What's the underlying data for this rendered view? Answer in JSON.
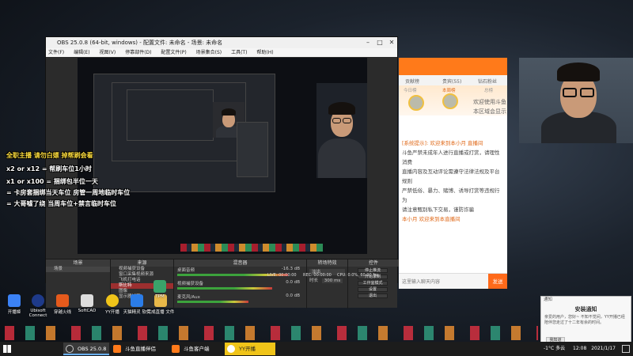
{
  "obs": {
    "title": "OBS 25.0.8 (64-bit, windows) - 配置文件: 未命名 - 场景: 未命名",
    "menu": [
      "文件(F)",
      "编辑(E)",
      "视图(V)",
      "停靠部件(D)",
      "配置文件(P)",
      "场景集合(S)",
      "工具(T)",
      "帮助(H)"
    ],
    "docks": {
      "scenes_header": "场景",
      "scene_item": "场景",
      "sources_header": "来源",
      "sources": [
        "视频捕获设备",
        "窗口采集视频来源",
        "飞机打电话",
        "斯比特",
        "图像",
        "显示器捕获"
      ],
      "mixer_header": "混音器",
      "mixer_channels": [
        {
          "name": "桌面音频",
          "level": "-16.3 dB"
        },
        {
          "name": "视频捕获设备",
          "level": "0.0 dB"
        },
        {
          "name": "麦克风/Aux",
          "level": "0.0 dB"
        }
      ],
      "transitions_header": "转场特效",
      "transition": "淡出",
      "duration_label": "时长",
      "duration_value": "300 ms",
      "controls_header": "控件",
      "controls": [
        "停止推流",
        "开始录制",
        "工作室模式",
        "设置",
        "退出"
      ]
    },
    "status": {
      "live": "LIVE: 00:00:00",
      "rec": "REC: 00:00:00",
      "cpu": "CPU: 0.0%, 60.00 fps"
    }
  },
  "danmaku": [
    "全职主播 请勿白嫖 掉帮刷会看",
    "x2 or x12 = 帮刷车位1小时",
    "x1 or x100 = 捆绑包半位一天",
    "= 卡房套捆绑当天车位 房管一周地临时车位",
    "= 大哥嘘了绕 当周车位+禁言临时车位"
  ],
  "chat": {
    "tabs": [
      "贡献榜",
      "贵宾(55)",
      "钻石粉丝"
    ],
    "rank_tabs": [
      "今日榜",
      "本周榜",
      "总榜"
    ],
    "welcome": "欢迎使用斗鱼",
    "region": "本区域会显示",
    "messages": [
      {
        "text": "[系统提示]: 欢迎来到本小月 直播间",
        "cls": "sys"
      },
      {
        "text": "斗鱼严禁未成年人进行直播或打赏，请理性消费",
        "cls": ""
      },
      {
        "text": "直播内容及互动评论需遵守法律法规及平台规则",
        "cls": ""
      },
      {
        "text": "严禁低俗、暴力、赌博、诱导打赏等违规行为",
        "cls": ""
      },
      {
        "text": "请注意甄别私下交易，谨防诈骗",
        "cls": ""
      },
      {
        "text": "本小月 欢迎来到本直播间",
        "cls": "sys"
      }
    ],
    "input_placeholder": "这里输入聊天内容",
    "send": "发送"
  },
  "desktop_icons": [
    {
      "label": "开播姬",
      "color": "#3b82f6"
    },
    {
      "label": "Ubisoft Connect",
      "color": "#1e3a8a"
    },
    {
      "label": "穿越火线",
      "color": "#e55a1c"
    },
    {
      "label": "SoftCAD",
      "color": "#ddd"
    },
    {
      "label": "YY开播",
      "color": "#f0c419"
    },
    {
      "label": "天猫精灵 软件",
      "color": "#2b7de9"
    },
    {
      "label": "完成直播 文件",
      "color": "#e8b849"
    },
    {
      "label": "TPM",
      "color": "#3aa36a"
    }
  ],
  "notification": {
    "app": "通知",
    "title": "安装通知",
    "body": "亲爱的用户，您好~ 不知不觉间，YY开播已经陪伴您走过了十二年有余的时间。",
    "button": "我知道"
  },
  "taskbar": {
    "items": [
      {
        "label": "OBS 25.0.8 (64-...",
        "color": "#333"
      },
      {
        "label": "斗鱼直播伴侣",
        "color": "#ff7a1a"
      },
      {
        "label": "斗鱼客户端",
        "color": "#ff7a1a"
      },
      {
        "label": "YY开播",
        "color": "#f0c419"
      }
    ],
    "temp": "-1°C 多云",
    "time": "12:08",
    "date": "2021/1/17"
  }
}
